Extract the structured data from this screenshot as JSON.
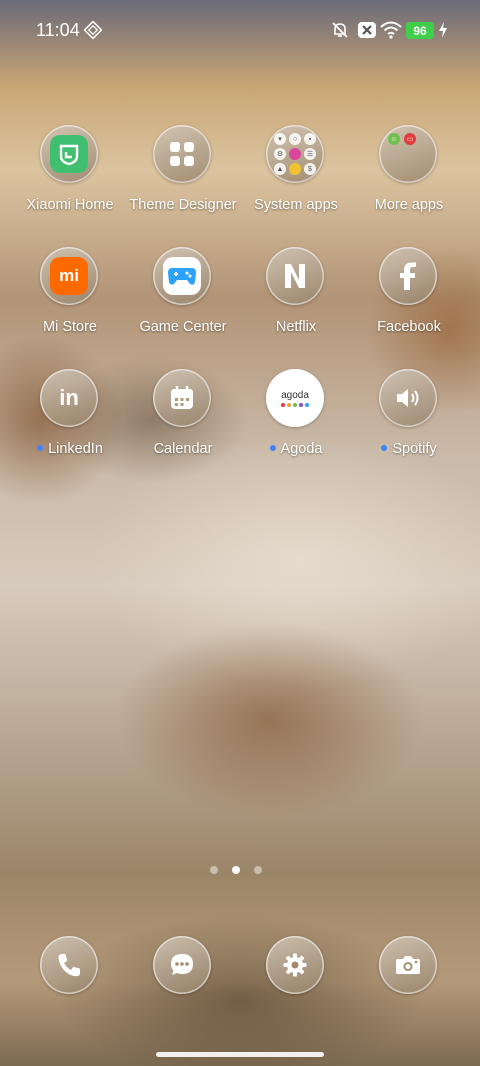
{
  "status_bar": {
    "time": "11:04",
    "battery_level": "96",
    "icons": [
      "vibrate-icon",
      "mute-icon",
      "no-sim-icon",
      "wifi-icon",
      "battery-icon",
      "charging-icon"
    ]
  },
  "apps": [
    {
      "label": "Xiaomi Home",
      "icon": "xiaomi-home-icon",
      "badge_dot": false
    },
    {
      "label": "Theme Designer",
      "icon": "theme-designer-icon",
      "badge_dot": false
    },
    {
      "label": "System apps",
      "icon": "folder-icon",
      "badge_dot": false
    },
    {
      "label": "More apps",
      "icon": "folder-icon",
      "badge_dot": false
    },
    {
      "label": "Mi Store",
      "icon": "mi-store-icon",
      "badge_dot": false
    },
    {
      "label": "Game Center",
      "icon": "gamepad-icon",
      "badge_dot": false
    },
    {
      "label": "Netflix",
      "icon": "netflix-icon",
      "badge_dot": false
    },
    {
      "label": "Facebook",
      "icon": "facebook-icon",
      "badge_dot": false
    },
    {
      "label": "LinkedIn",
      "icon": "linkedin-icon",
      "badge_dot": true
    },
    {
      "label": "Calendar",
      "icon": "calendar-icon",
      "badge_dot": false
    },
    {
      "label": "Agoda",
      "icon": "agoda-icon",
      "badge_dot": true
    },
    {
      "label": "Spotify",
      "icon": "spotify-icon",
      "badge_dot": true
    }
  ],
  "agoda_logo_text": "agoda",
  "mi_logo_text": "mi",
  "pager": {
    "count": 3,
    "active_index": 1
  },
  "dock": [
    "phone-icon",
    "messages-icon",
    "settings-icon",
    "camera-icon"
  ],
  "colors": {
    "accent_dot": "#3d82ff",
    "battery": "#3fcf4a",
    "xiaomi_home": "#3fbf6f",
    "mi_store": "#ff6a00",
    "game_center": "#2ea2ff"
  }
}
